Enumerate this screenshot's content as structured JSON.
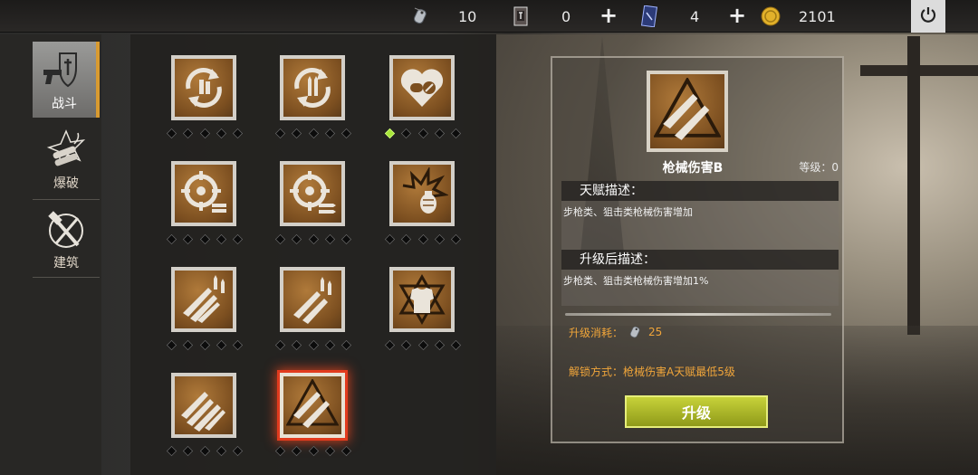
{
  "resources": {
    "tags": {
      "icon": "dog-tag-icon",
      "value": "10"
    },
    "tickets": {
      "icon": "ticket-icon",
      "value": "0"
    },
    "cards": {
      "icon": "card-icon",
      "value": "4"
    },
    "coins": {
      "icon": "gold-coin-icon",
      "value": "2101"
    }
  },
  "sidebar": {
    "tabs": [
      {
        "label": "战斗",
        "icon": "pistol-shield-icon",
        "active": true
      },
      {
        "label": "爆破",
        "icon": "dynamite-icon",
        "active": false
      },
      {
        "label": "建筑",
        "icon": "hammer-saw-icon",
        "active": false
      }
    ]
  },
  "talents": [
    {
      "icon": "reload-pistol-ammo-icon",
      "level": 0,
      "max": 5
    },
    {
      "icon": "reload-rifle-ammo-icon",
      "level": 0,
      "max": 5
    },
    {
      "icon": "medkit-heart-icon",
      "level": 1,
      "max": 5
    },
    {
      "icon": "crosshair-pistol-ammo-icon",
      "level": 0,
      "max": 5
    },
    {
      "icon": "crosshair-rifle-ammo-icon",
      "level": 0,
      "max": 5
    },
    {
      "icon": "grenade-explosion-icon",
      "level": 0,
      "max": 5
    },
    {
      "icon": "weapons-damage-a-icon",
      "level": 0,
      "max": 5
    },
    {
      "icon": "rifles-damage-icon",
      "level": 0,
      "max": 5
    },
    {
      "icon": "body-armor-icon",
      "level": 0,
      "max": 5
    },
    {
      "icon": "weapons-damage-c-icon",
      "level": 0,
      "max": 5
    },
    {
      "icon": "weapons-damage-b-icon",
      "level": 0,
      "max": 5,
      "selected": true
    }
  ],
  "detail": {
    "icon": "weapons-damage-b-icon",
    "name": "枪械伤害B",
    "level_text": "等级：0",
    "desc_title": "天赋描述：",
    "desc": "步枪类、狙击类枪械伤害增加",
    "upgrade_title": "升级后描述：",
    "upgrade_desc": "步枪类、狙击类枪械伤害增加1%",
    "cost_label": "升级消耗：",
    "cost_value": "25",
    "unlock": "解锁方式：枪械伤害A天赋最低5级",
    "button": "升级"
  },
  "colors": {
    "accent_orange": "#f0a53a",
    "button_green": "#a9b52a",
    "selected_glow": "#e23b1e",
    "lit_dot": "#a8e63a"
  }
}
